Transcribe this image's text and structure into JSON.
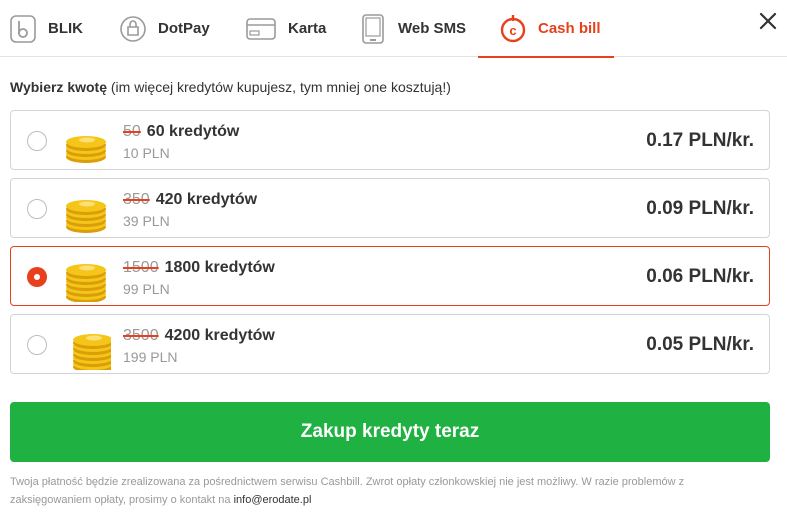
{
  "tabs": [
    {
      "label": "BLIK",
      "icon": "blik-icon"
    },
    {
      "label": "DotPay",
      "icon": "dotpay-icon"
    },
    {
      "label": "Karta",
      "icon": "card-icon"
    },
    {
      "label": "Web SMS",
      "icon": "phone-icon"
    },
    {
      "label": "Cash bill",
      "icon": "cashbill-icon",
      "active": true
    }
  ],
  "heading": {
    "bold": "Wybierz kwotę",
    "rest": " (im więcej kredytów kupujesz, tym mniej one kosztują!)"
  },
  "options": [
    {
      "old": "50",
      "credits": "60 kredytów",
      "price": "10 PLN",
      "unit": "0.17 PLN/kr.",
      "selected": false
    },
    {
      "old": "350",
      "credits": "420 kredytów",
      "price": "39 PLN",
      "unit": "0.09 PLN/kr.",
      "selected": false
    },
    {
      "old": "1500",
      "credits": "1800 kredytów",
      "price": "99 PLN",
      "unit": "0.06 PLN/kr.",
      "selected": true
    },
    {
      "old": "3500",
      "credits": "4200 kredytów",
      "price": "199 PLN",
      "unit": "0.05 PLN/kr.",
      "selected": false
    }
  ],
  "buy_button": "Zakup kredyty teraz",
  "footer": {
    "text": "Twoja płatność będzie zrealizowana za pośrednictwem serwisu Cashbill. Zwrot opłaty członkowskiej nie jest możliwy. W razie problemów z zaksięgowaniem opłaty, prosimy o kontakt na ",
    "email": "info@erodate.pl"
  },
  "colors": {
    "accent": "#e8401c",
    "buy": "#1fb141",
    "coin": "#f5c518"
  }
}
